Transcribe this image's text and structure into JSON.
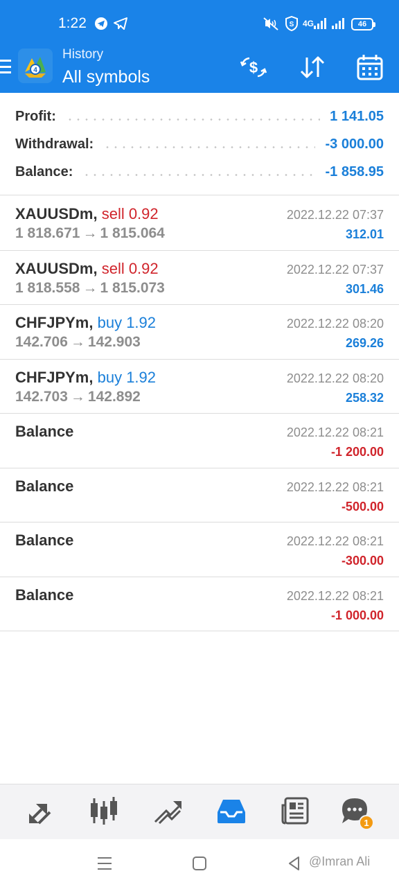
{
  "status_bar": {
    "time": "1:22",
    "network_label": "4G",
    "battery": "46"
  },
  "header": {
    "subtitle": "History",
    "title": "All symbols"
  },
  "summary": {
    "profit_label": "Profit:",
    "profit_value": "1 141.05",
    "withdrawal_label": "Withdrawal:",
    "withdrawal_value": "-3 000.00",
    "balance_label": "Balance:",
    "balance_value": "-1 858.95"
  },
  "deals": [
    {
      "symbol": "XAUUSDm,",
      "action": "sell 0.92",
      "open": "1 818.671",
      "arrow": "→",
      "close": "1 815.064",
      "datetime": "2022.12.22 07:37",
      "amount": "312.01"
    },
    {
      "symbol": "XAUUSDm,",
      "action": "sell 0.92",
      "open": "1 818.558",
      "arrow": "→",
      "close": "1 815.073",
      "datetime": "2022.12.22 07:37",
      "amount": "301.46"
    },
    {
      "symbol": "CHFJPYm,",
      "action": "buy 1.92",
      "open": "142.706",
      "arrow": "→",
      "close": "142.903",
      "datetime": "2022.12.22 08:20",
      "amount": "269.26"
    },
    {
      "symbol": "CHFJPYm,",
      "action": "buy 1.92",
      "open": "142.703",
      "arrow": "→",
      "close": "142.892",
      "datetime": "2022.12.22 08:20",
      "amount": "258.32"
    },
    {
      "symbol": "Balance",
      "datetime": "2022.12.22 08:21",
      "amount": "-1 200.00"
    },
    {
      "symbol": "Balance",
      "datetime": "2022.12.22 08:21",
      "amount": "-500.00"
    },
    {
      "symbol": "Balance",
      "datetime": "2022.12.22 08:21",
      "amount": "-300.00"
    },
    {
      "symbol": "Balance",
      "datetime": "2022.12.22 08:21",
      "amount": "-1 000.00"
    }
  ],
  "tabbar": {
    "chat_badge": "1"
  },
  "watermark": "@Imran Ali",
  "colors": {
    "primary_blue": "#1a83e8",
    "profit_blue": "#1a7fd9",
    "loss_red": "#d0242b",
    "badge_orange": "#f39a12"
  },
  "icons": {
    "header": [
      "menu-icon",
      "app-logo-icon",
      "currency-exchange-icon",
      "sort-icon",
      "calendar-icon"
    ],
    "tabs": [
      "quotes-icon",
      "chart-icon",
      "trade-icon",
      "history-icon",
      "news-icon",
      "chat-icon"
    ],
    "nav": [
      "recents-icon",
      "home-icon",
      "back-icon"
    ]
  }
}
